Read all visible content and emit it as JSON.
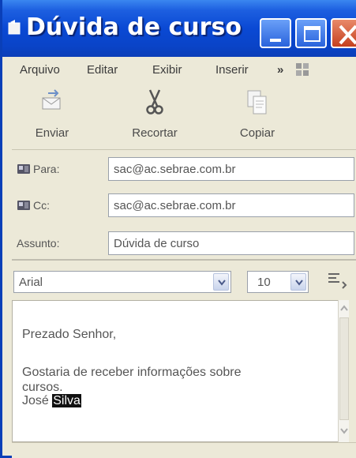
{
  "window": {
    "title": "Dúvida de curso"
  },
  "menu": {
    "items": [
      {
        "label": "Arquivo"
      },
      {
        "label": "Editar"
      },
      {
        "label": "Exibir"
      },
      {
        "label": "Inserir"
      }
    ],
    "overflow": "»"
  },
  "toolbar": {
    "buttons": [
      {
        "label": "Enviar",
        "icon": "send-icon"
      },
      {
        "label": "Recortar",
        "icon": "scissors-icon"
      },
      {
        "label": "Copiar",
        "icon": "copy-icon"
      }
    ]
  },
  "addressing": {
    "to": {
      "label": "Para:",
      "value": "sac@ac.sebrae.com.br"
    },
    "cc": {
      "label": "Cc:",
      "value": "sac@ac.sebrae.com.br"
    },
    "subject": {
      "label": "Assunto:",
      "value": "Dúvida de curso"
    }
  },
  "format": {
    "font": "Arial",
    "size": "10"
  },
  "body": {
    "greeting": "Prezado Senhor,",
    "line1": "Gostaria de receber informações sobre",
    "line2": "cursos.",
    "signature_first": "José",
    "signature_last": "Silva"
  },
  "colors": {
    "titlebar": "#0a49d4",
    "chrome": "#ece9d8",
    "selection": "#111111"
  }
}
